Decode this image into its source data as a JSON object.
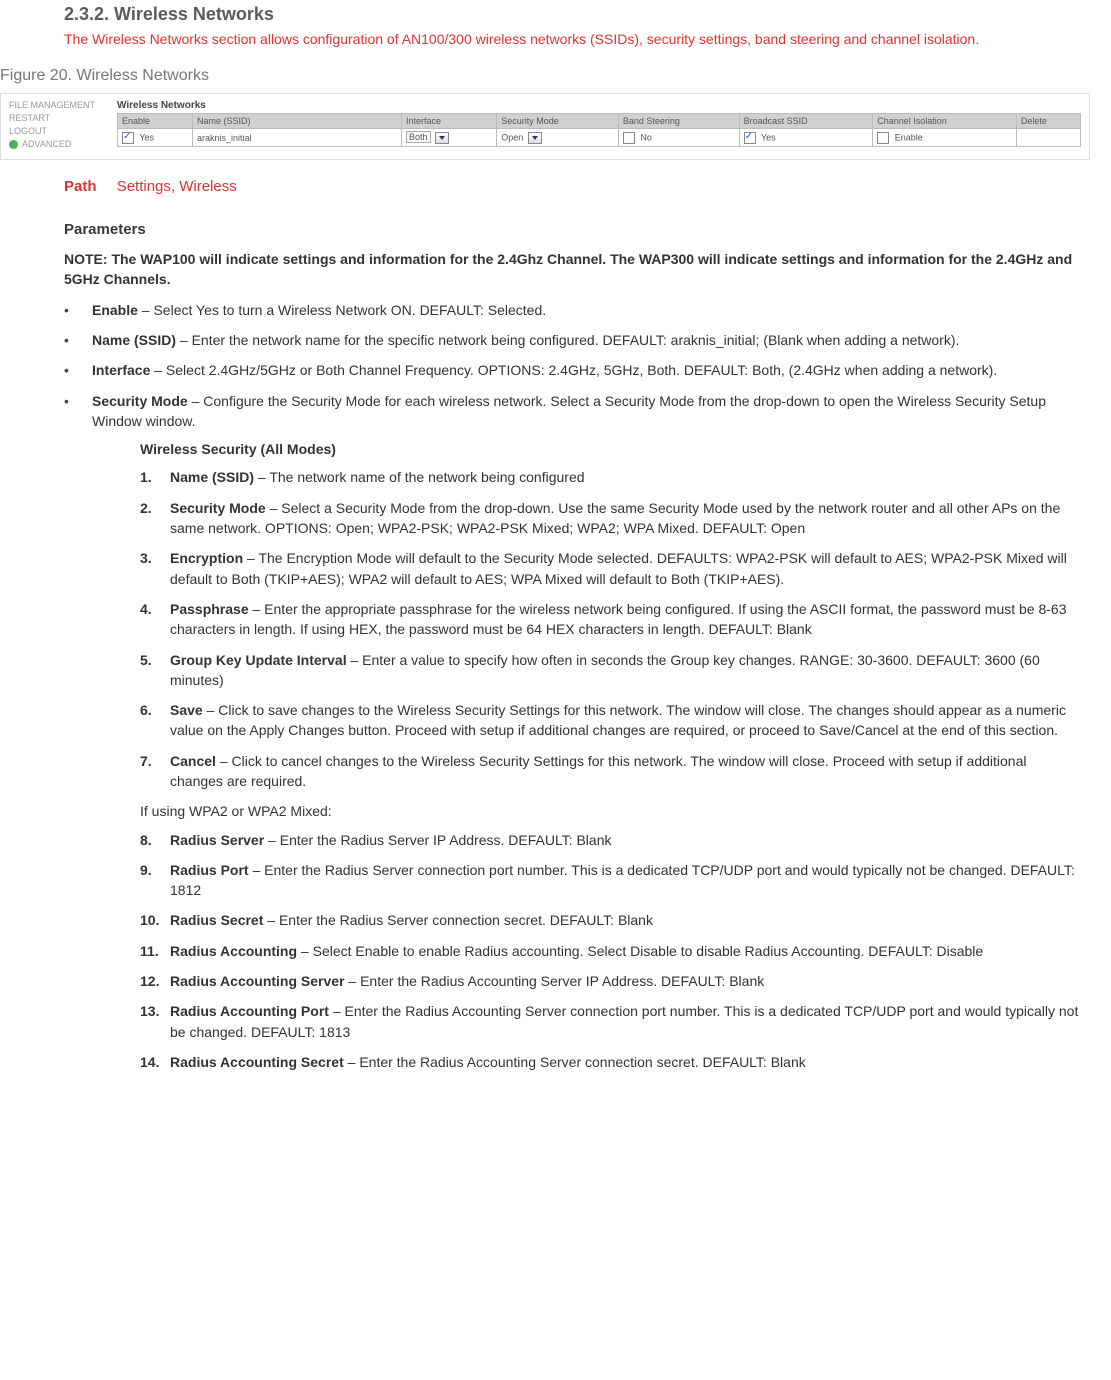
{
  "heading": {
    "number_title": "2.3.2. Wireless Networks",
    "intro": "The Wireless Networks section allows configuration of AN100/300 wireless networks (SSIDs), security settings, band steering and channel isolation."
  },
  "figure": {
    "caption": "Figure 20. Wireless Networks",
    "sidebar": {
      "file_mgmt": "FILE MANAGEMENT",
      "restart": "RESTART",
      "logout": "LOGOUT",
      "advanced": "ADVANCED"
    },
    "panel_title": "Wireless Networks",
    "headers": {
      "enable": "Enable",
      "name": "Name (SSID)",
      "interface": "Interface",
      "security": "Security Mode",
      "bandsteer": "Band Steering",
      "broadcast": "Broadcast SSID",
      "chiso": "Channel Isolation",
      "delete": "Delete"
    },
    "row": {
      "enable_checked": "Yes",
      "name": "araknis_initial",
      "interface": "Both",
      "security": "Open",
      "bandsteer": "No",
      "broadcast": "Yes",
      "chiso": "Enable"
    }
  },
  "path": {
    "label": "Path",
    "value": "Settings, Wireless"
  },
  "params": {
    "heading": "Parameters",
    "note": "NOTE: The WAP100 will indicate settings and information for the 2.4Ghz Channel. The WAP300 will indicate settings and information for the 2.4GHz and 5GHz Channels.",
    "bullets": [
      {
        "term": "Enable",
        "text": " – Select Yes to turn a Wireless Network ON. DEFAULT: Selected."
      },
      {
        "term": "Name (SSID)",
        "text": " – Enter the network name for the specific network being configured. DEFAULT: araknis_initial; (Blank when adding a network)."
      },
      {
        "term": "Interface",
        "text": " – Select 2.4GHz/5GHz or Both Channel Frequency. OPTIONS: 2.4GHz, 5GHz, Both. DEFAULT: Both, (2.4GHz when adding a network)."
      },
      {
        "term": "Security Mode",
        "text": " – Configure the Security Mode for each wireless network. Select a Security Mode from the drop-down to open the Wireless Security Setup Window window."
      }
    ],
    "sub_title": "Wireless Security (All Modes)",
    "numbered_a": [
      {
        "term": "Name (SSID)",
        "text": " – The network name of the network being configured"
      },
      {
        "term": "Security Mode",
        "text": " – Select a Security Mode from the drop-down. Use the same Security Mode used by the network router and all other APs on the same network. OPTIONS: Open; WPA2-PSK; WPA2-PSK Mixed; WPA2; WPA Mixed. DEFAULT: Open"
      },
      {
        "term": "Encryption",
        "text": " – The Encryption Mode will default to the Security Mode selected. DEFAULTS: WPA2-PSK will default to AES; WPA2-PSK Mixed will default to Both (TKIP+AES); WPA2 will default to AES; WPA Mixed will default to Both (TKIP+AES)."
      },
      {
        "term": "Passphrase",
        "text": " – Enter the appropriate passphrase for the wireless network being configured. If using the ASCII format, the password must be 8-63 characters in length. If using HEX, the password must be 64 HEX characters in length. DEFAULT: Blank"
      },
      {
        "term": "Group Key Update Interval",
        "text": " – Enter a value to specify how often in seconds the Group key changes. RANGE: 30-3600. DEFAULT: 3600 (60 minutes)"
      },
      {
        "term": "Save",
        "text": " – Click to save changes to the Wireless Security Settings for this network. The window will close. The changes should appear as a numeric value on the Apply Changes button. Proceed with setup if additional changes are required, or proceed to Save/Cancel at the end of this section."
      },
      {
        "term": "Cancel",
        "text": " – Click to cancel changes to the Wireless Security Settings for this network. The window will close. Proceed with setup if additional changes are required."
      }
    ],
    "mid_note": "If using WPA2 or WPA2 Mixed:",
    "numbered_b": [
      {
        "term": "Radius Server",
        "text": " – Enter the Radius Server IP Address. DEFAULT: Blank"
      },
      {
        "term": "Radius Port",
        "text": " – Enter the Radius Server connection port number. This is a dedicated TCP/UDP port and would typically not be changed. DEFAULT: 1812"
      },
      {
        "term": "Radius Secret",
        "text": " – Enter the Radius Server connection secret. DEFAULT: Blank"
      },
      {
        "term": "Radius Accounting",
        "text": " – Select Enable to enable Radius accounting. Select Disable to disable Radius Accounting. DEFAULT: Disable"
      },
      {
        "term": "Radius Accounting Server",
        "text": " – Enter the Radius Accounting Server IP Address. DEFAULT: Blank"
      },
      {
        "term": "Radius Accounting Port",
        "text": " – Enter the Radius Accounting Server connection port number. This is a dedicated TCP/UDP port and would typically not be changed. DEFAULT: 1813"
      },
      {
        "term": "Radius Accounting Secret",
        "text": " – Enter the Radius Accounting Server connection secret. DEFAULT: Blank"
      }
    ]
  }
}
